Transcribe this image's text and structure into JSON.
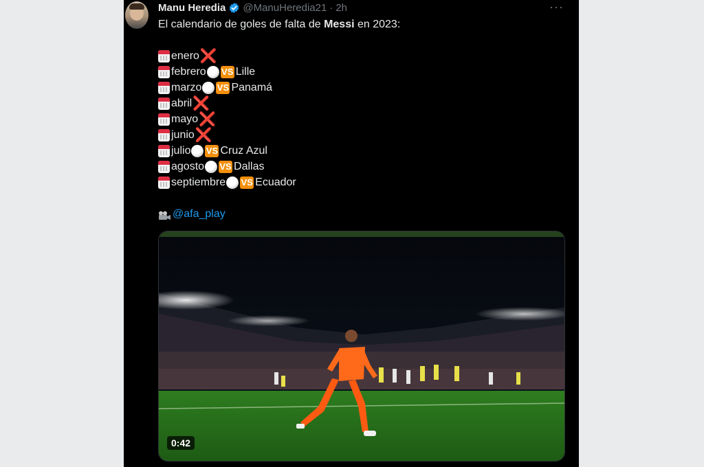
{
  "tweet": {
    "author_name": "Manu Heredia",
    "handle": "@ManuHeredia21",
    "separator": "·",
    "time": "2h",
    "more_label": "···",
    "intro_before": "El calendario de goles de falta de ",
    "intro_bold": "Messi",
    "intro_after": " en 2023:",
    "months": [
      {
        "month": "enero",
        "goal": false
      },
      {
        "month": "febrero",
        "goal": true,
        "vs": "VS",
        "opponent": "Lille"
      },
      {
        "month": "marzo",
        "goal": true,
        "vs": "VS",
        "opponent": "Panamá"
      },
      {
        "month": "abril",
        "goal": false
      },
      {
        "month": "mayo",
        "goal": false
      },
      {
        "month": "junio",
        "goal": false
      },
      {
        "month": "julio",
        "goal": true,
        "vs": "VS",
        "opponent": "Cruz Azul"
      },
      {
        "month": "agosto",
        "goal": true,
        "vs": "VS",
        "opponent": "Dallas"
      },
      {
        "month": "septiembre",
        "goal": true,
        "vs": "VS",
        "opponent": "Ecuador"
      }
    ],
    "cross_mark": "❌",
    "source_link": "@afa_play",
    "video_duration": "0:42"
  },
  "icons": {
    "calendar": "calendar-icon",
    "cross": "cross-mark-icon",
    "ball": "soccer-ball-icon",
    "vs": "vs-badge-icon",
    "camera": "movie-camera-icon",
    "verified": "verified-badge-icon"
  },
  "colors": {
    "background": "#000000",
    "text": "#e7e9ea",
    "muted": "#71767b",
    "link": "#1d9bf0",
    "verified": "#1d9bf0",
    "vs_badge": "#f4900c",
    "cross": "#dd2e44"
  }
}
